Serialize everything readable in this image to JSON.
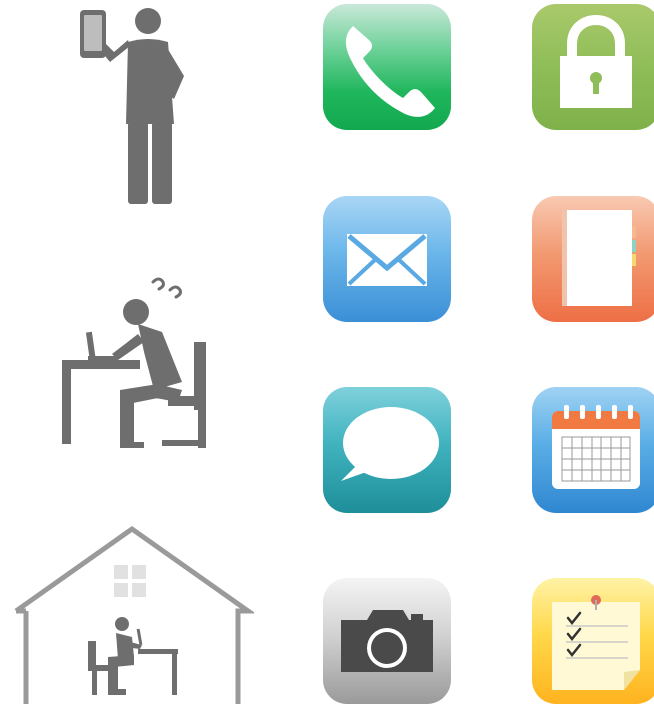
{
  "illustrations": [
    {
      "name": "person-with-tablet",
      "icon": "standing-person-holding-tablet"
    },
    {
      "name": "person-at-desk-worried",
      "icon": "seated-person-laptop-confused"
    },
    {
      "name": "home-office",
      "icon": "house-with-person-at-laptop"
    }
  ],
  "app_icons": [
    {
      "name": "phone",
      "icon": "phone-handset-icon"
    },
    {
      "name": "lock",
      "icon": "padlock-icon"
    },
    {
      "name": "mail",
      "icon": "envelope-icon"
    },
    {
      "name": "contacts",
      "icon": "address-book-icon"
    },
    {
      "name": "messages",
      "icon": "speech-bubble-icon"
    },
    {
      "name": "calendar",
      "icon": "calendar-icon"
    },
    {
      "name": "camera",
      "icon": "camera-icon"
    },
    {
      "name": "notes",
      "icon": "memo-checklist-icon"
    }
  ],
  "colors": {
    "figure_gray": "#6e6e6e",
    "house_outline": "#9a9a9a",
    "phone_green": "#1fb65c",
    "lock_green": "#8fbd58",
    "mail_blue": "#3a8fd6",
    "book_orange": "#ee6f45",
    "chat_teal": "#1e8f99",
    "calendar_blue": "#2f87d0",
    "camera_gray": "#9a9a9a",
    "notes_yellow": "#ffb31f"
  }
}
